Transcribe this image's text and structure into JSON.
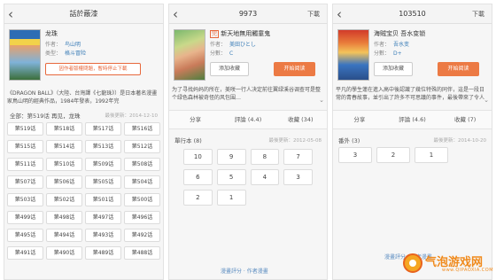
{
  "panel1": {
    "title": "話於蔽漆",
    "name": "龙珠",
    "author_label": "作者：",
    "author": "鸟山明",
    "genre_label": "类型：",
    "genre": "格斗冒险",
    "warning": "因作者版權問題，暫時停止下載",
    "description": "《DRAGON BALL》（大陸、台灣譯《七龍珠》）是日本著名漫畫家鳥山明的經典作品，1984年發表，1992年完",
    "chapter_header": "全部：第519话 再见，龙珠",
    "updated": "最後更新：2014-12-10",
    "chapters": [
      "第519话",
      "第518话",
      "第517话",
      "第516话",
      "第515话",
      "第514话",
      "第513话",
      "第512话",
      "第511话",
      "第510话",
      "第509话",
      "第508话",
      "第507话",
      "第506话",
      "第505话",
      "第504话",
      "第503话",
      "第502话",
      "第501话",
      "第500话",
      "第499话",
      "第498话",
      "第497话",
      "第496话",
      "第495话",
      "第494话",
      "第493话",
      "第492话",
      "第491话",
      "第490话",
      "第489话",
      "第488话"
    ]
  },
  "panel2": {
    "title": "9973",
    "download": "下載",
    "tag": "完",
    "name": "新天地無用觸童鬼",
    "author_label": "作者：",
    "author": "美田ひとし",
    "genre_label": "分數：",
    "genre": "C",
    "fav_button": "添加收藏",
    "read_button": "开始阅读",
    "description": "为了寻找妈妈的所在，美咲一行人决定前往翼绿溪谷调查可是整个绿色森林被奇怪的风包围…",
    "stats": [
      "分享",
      "評論 (4.4)",
      "收藏 (34)"
    ],
    "volume_header": "單行本 (8)",
    "updated": "最後更新：2012-05-08",
    "volumes": [
      "10",
      "9",
      "8",
      "7",
      "6",
      "5",
      "4",
      "3",
      "2",
      "1"
    ],
    "more": "漫畫評分  ·  作者漫畫"
  },
  "panel3": {
    "title": "103510",
    "download": "下載",
    "name": "海贼宝贝 吾水变锁",
    "author_label": "作者：",
    "author": "吾水变",
    "genre_label": "分數：",
    "genre": "D+",
    "fav_button": "添加收藏",
    "read_button": "开始阅读",
    "description": "平凡的學生蓮在進入高中後認識了幾位特殊的同伴，這是一段日常的青春故事，並引出了許多不可思議的事件，最後帶來了令人感動的結局…",
    "stats": [
      "分享",
      "評論 (4.6)",
      "收藏 (7)"
    ],
    "volume_header": "番外 (3)",
    "updated": "最後更新：2014-10-20",
    "volumes": [
      "3",
      "2",
      "1"
    ],
    "more": "漫畫評分  ·  作者漫畫"
  },
  "watermark": {
    "brand": "气泡游戏网",
    "url": "www.QIPAOXIA.COM"
  }
}
